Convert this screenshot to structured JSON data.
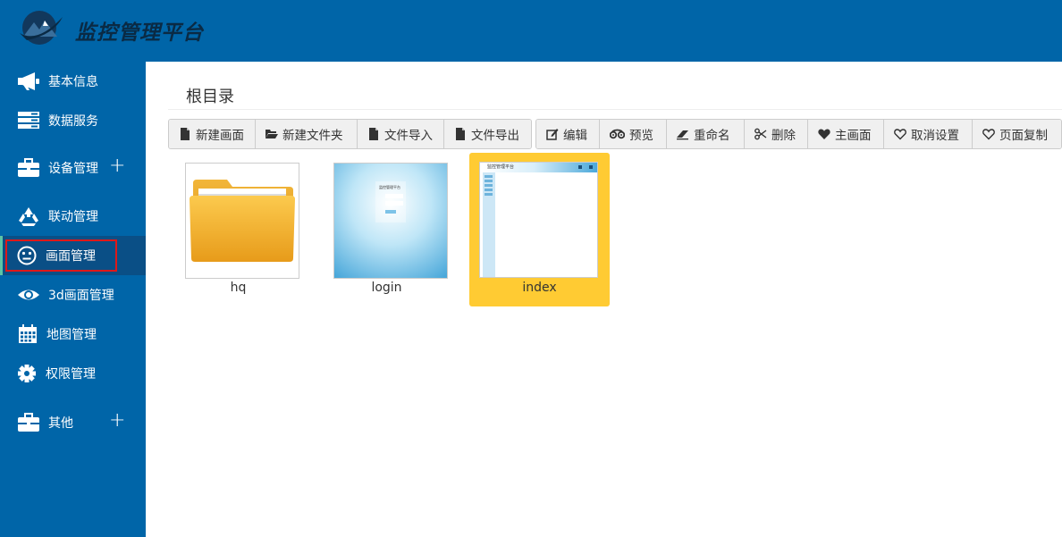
{
  "header": {
    "title": "监控管理平台",
    "logo_icon": "mountain-logo-icon"
  },
  "sidebar": {
    "items": [
      {
        "label": "基本信息",
        "icon": "bullhorn-icon"
      },
      {
        "label": "数据服务",
        "icon": "server-icon"
      },
      {
        "label": "设备管理",
        "icon": "briefcase-icon",
        "expand": "+"
      },
      {
        "label": "联动管理",
        "icon": "recycle-icon"
      },
      {
        "label": "画面管理",
        "icon": "smiley-icon"
      },
      {
        "label": "3d画面管理",
        "icon": "eye-icon"
      },
      {
        "label": "地图管理",
        "icon": "calendar-icon"
      },
      {
        "label": "权限管理",
        "icon": "gear-icon"
      },
      {
        "label": "其他",
        "icon": "briefcase-icon",
        "expand": "+"
      }
    ],
    "active": "画面管理"
  },
  "main": {
    "breadcrumb": "根目录",
    "toolbar_left": [
      {
        "label": "新建画面",
        "icon": "file-icon"
      },
      {
        "label": "新建文件夹",
        "icon": "folder-open-icon"
      },
      {
        "label": "文件导入",
        "icon": "file-icon"
      },
      {
        "label": "文件导出",
        "icon": "file-icon"
      }
    ],
    "toolbar_right": [
      {
        "label": "编辑",
        "icon": "edit-icon"
      },
      {
        "label": "预览",
        "icon": "binoculars-icon"
      },
      {
        "label": "重命名",
        "icon": "eraser-icon"
      },
      {
        "label": "删除",
        "icon": "scissors-icon"
      },
      {
        "label": "主画面",
        "icon": "heart-filled-icon"
      },
      {
        "label": "取消设置",
        "icon": "heart-outline-icon"
      },
      {
        "label": "页面复制",
        "icon": "heart-outline-icon"
      }
    ],
    "files": [
      {
        "name": "hq",
        "type": "folder",
        "selected": false
      },
      {
        "name": "login",
        "type": "screen",
        "selected": false
      },
      {
        "name": "index",
        "type": "screen",
        "selected": true
      }
    ],
    "login_thumb_text": "监控管理平台",
    "index_thumb_text": "监控管理平台"
  },
  "colors": {
    "header_bg": "#0065a8",
    "sidebar_bg": "#0065a8",
    "sidebar_active_bg": "#0a4f86",
    "selected_tile": "#ffcb33",
    "highlight_box": "#e01818"
  }
}
